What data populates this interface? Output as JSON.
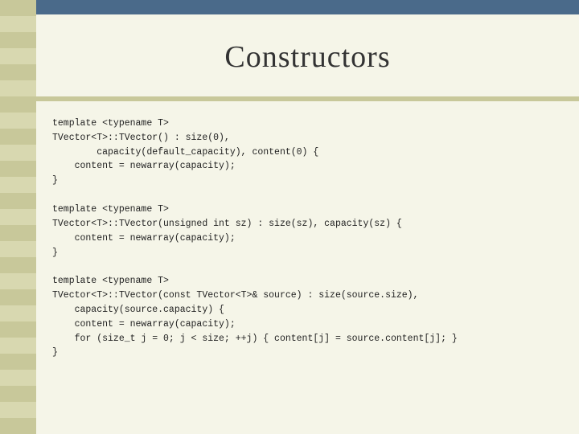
{
  "page": {
    "title": "Constructors",
    "background_color": "#f5f5e8",
    "accent_color": "#4a6a8a",
    "stripe_color": "#c8c89a"
  },
  "code_blocks": [
    {
      "id": "block1",
      "lines": [
        "template <typename T>",
        "TVector<T>::TVector() : size(0),",
        "        capacity(default_capacity), content(0) {",
        "    content = newarray(capacity);",
        "}"
      ]
    },
    {
      "id": "block2",
      "lines": [
        "template <typename T>",
        "TVector<T>::TVector(unsigned int sz) : size(sz), capacity(sz) {",
        "    content = newarray(capacity);",
        "}"
      ]
    },
    {
      "id": "block3",
      "lines": [
        "template <typename T>",
        "TVector<T>::TVector(const TVector<T>& source) : size(source.size),",
        "    capacity(source.capacity) {",
        "    content = newarray(capacity);",
        "    for (size_t j = 0; j < size; ++j) { content[j] = source.content[j]; }",
        "}"
      ]
    }
  ]
}
